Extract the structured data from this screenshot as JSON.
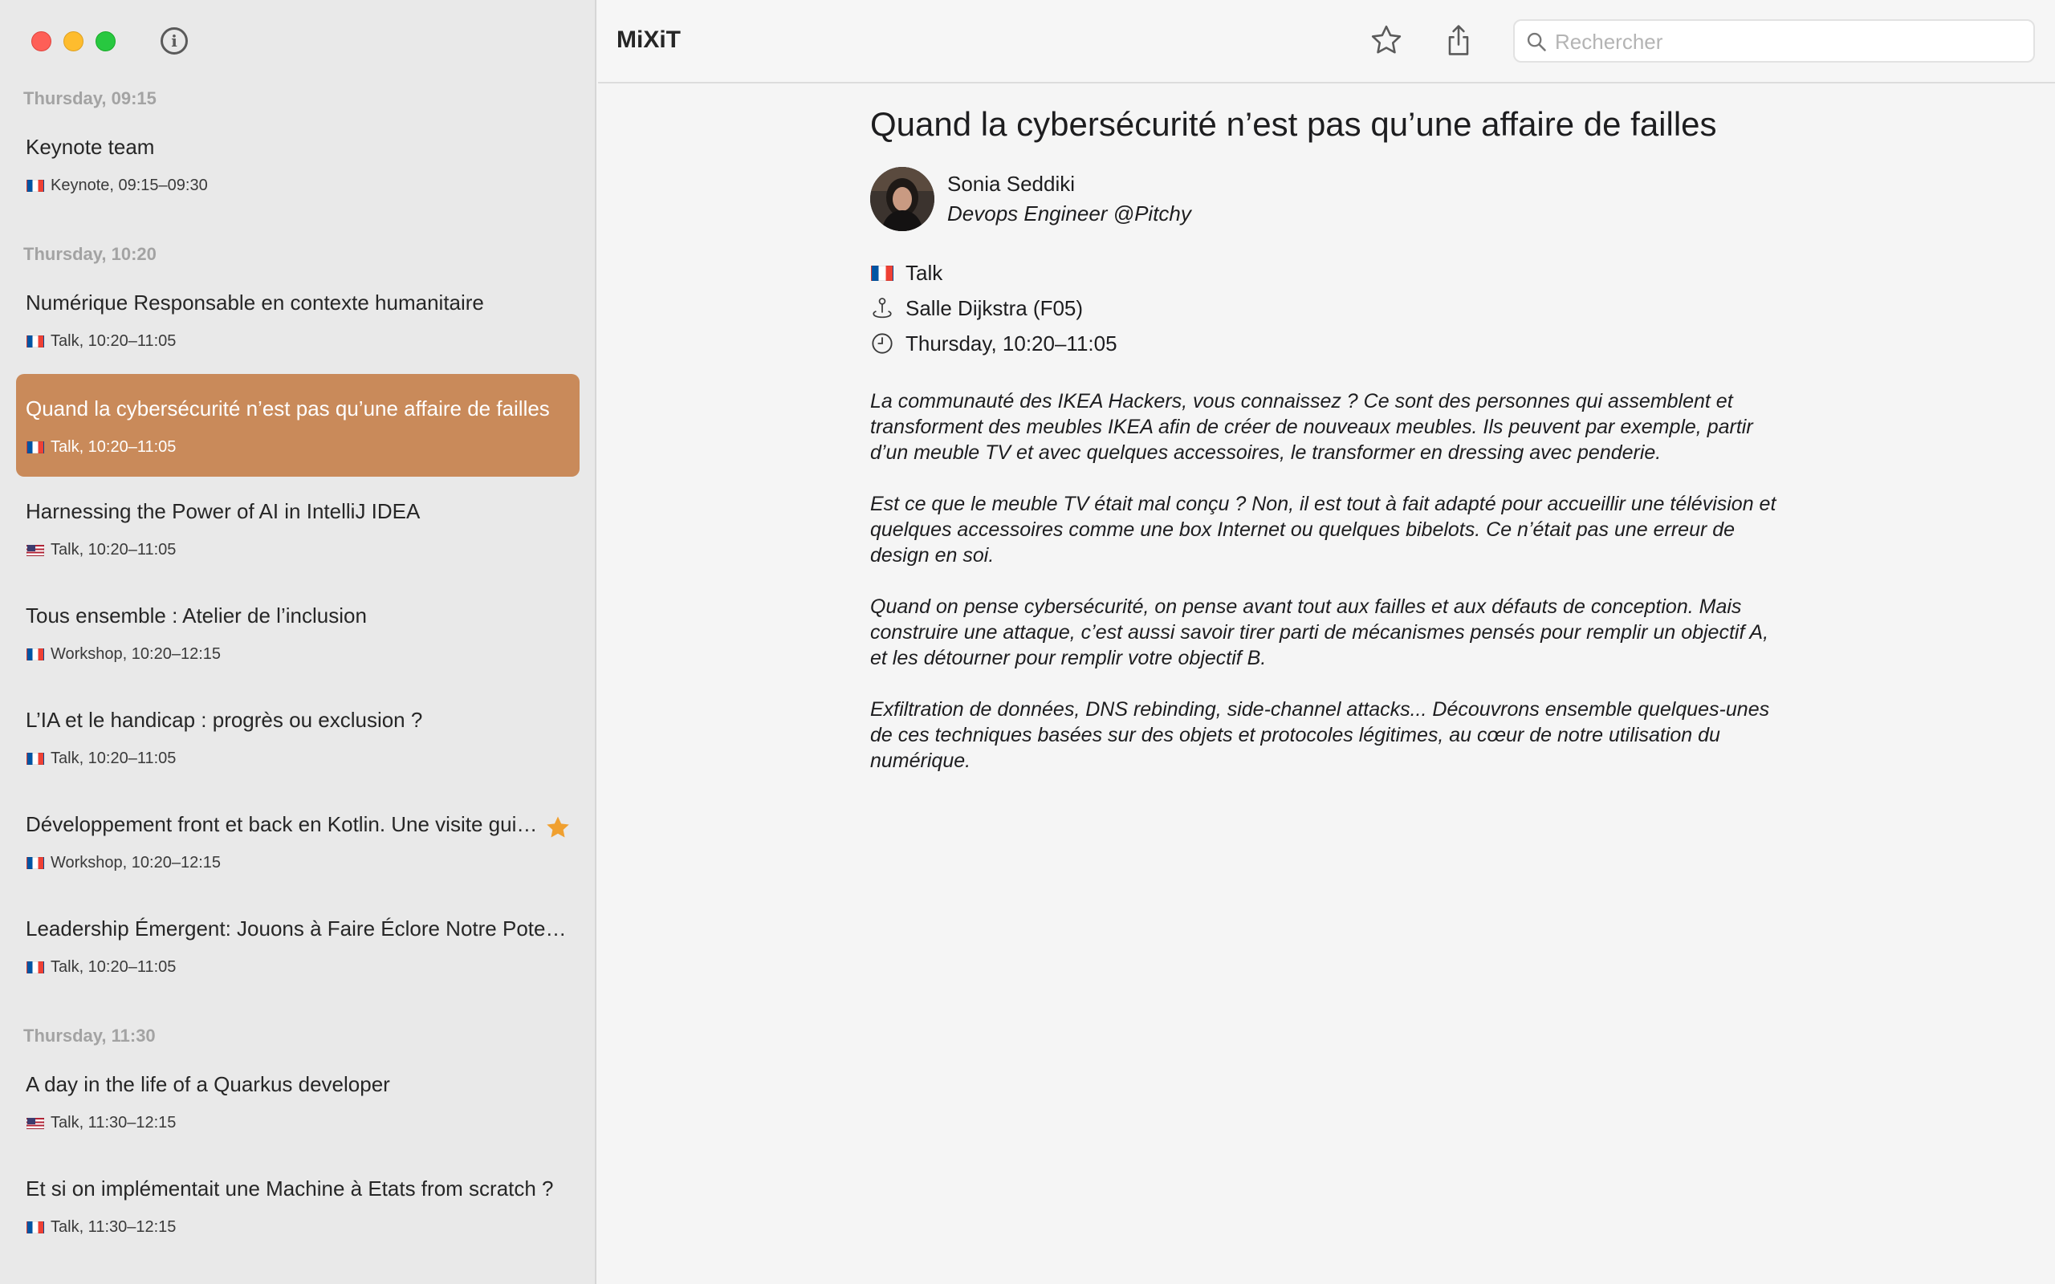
{
  "app": {
    "title": "MiXiT"
  },
  "window": {
    "info_label": "i"
  },
  "search": {
    "placeholder": "Rechercher",
    "value": ""
  },
  "sidebar": {
    "groups": [
      {
        "header": "Thursday, 09:15"
      },
      {
        "header": "Thursday, 10:20"
      },
      {
        "header": "Thursday, 11:30"
      }
    ],
    "sessions": [
      {
        "title": "Keynote team",
        "meta": "Keynote, 09:15–09:30",
        "flag": "fr"
      },
      {
        "title": "Numérique Responsable en contexte humanitaire",
        "meta": "Talk, 10:20–11:05",
        "flag": "fr"
      },
      {
        "title": "Quand la cybersécurité n’est pas qu’une affaire de failles",
        "meta": "Talk, 10:20–11:05",
        "flag": "fr",
        "selected": true
      },
      {
        "title": "Harnessing the Power of AI in IntelliJ IDEA",
        "meta": "Talk, 10:20–11:05",
        "flag": "us"
      },
      {
        "title": "Tous ensemble : Atelier de l’inclusion",
        "meta": "Workshop, 10:20–12:15",
        "flag": "fr"
      },
      {
        "title": "L’IA et le handicap : progrès ou exclusion ?",
        "meta": "Talk, 10:20–11:05",
        "flag": "fr"
      },
      {
        "title": "Développement front et back en Kotlin. Une visite guidée",
        "meta": "Workshop, 10:20–12:15",
        "flag": "fr",
        "favorite": true
      },
      {
        "title": "Leadership Émergent: Jouons à Faire Éclore Notre Potentiel",
        "meta": "Talk, 10:20–11:05",
        "flag": "fr"
      },
      {
        "title": "A day in the life of a Quarkus developer",
        "meta": "Talk, 11:30–12:15",
        "flag": "us"
      },
      {
        "title": "Et si on implémentait une Machine à Etats from scratch ?",
        "meta": "Talk, 11:30–12:15",
        "flag": "fr"
      }
    ]
  },
  "detail": {
    "title": "Quand la cybersécurité n’est pas qu’une affaire de failles",
    "speaker": {
      "name": "Sonia Seddiki",
      "role": "Devops Engineer @Pitchy"
    },
    "format": "Talk",
    "room": "Salle Dijkstra (F05)",
    "time": "Thursday, 10:20–11:05",
    "description": [
      "La communauté des IKEA Hackers, vous connaissez ? Ce sont des personnes qui assemblent et transforment des meubles IKEA afin de créer de nouveaux meubles. Ils peuvent par exemple, partir d’un meuble TV et avec quelques accessoires, le transformer en dressing avec penderie.",
      "Est ce que le meuble TV était mal conçu ? Non, il est tout à fait adapté pour accueillir une télévision et quelques accessoires comme une box Internet ou quelques bibelots. Ce n’était pas une erreur de design en soi.",
      "Quand on pense cybersécurité, on pense avant tout aux failles et aux défauts de conception. Mais construire une attaque, c’est aussi savoir tirer parti de mécanismes pensés pour remplir un objectif A, et les détourner pour remplir votre objectif B.",
      "Exfiltration de données, DNS rebinding, side-channel attacks... Découvrons ensemble quelques-unes de ces techniques basées sur des objets et protocoles légitimes, au cœur de notre utilisation du numérique."
    ]
  },
  "colors": {
    "selection": "#c98a5a",
    "favorite_star": "#f0a030",
    "sidebar_bg": "#e9e9e9",
    "content_bg": "#f5f5f5"
  },
  "icons": [
    "info-icon",
    "star-icon",
    "share-icon",
    "search-icon",
    "flag-fr-icon",
    "flag-us-icon",
    "location-pin-icon",
    "clock-icon"
  ]
}
